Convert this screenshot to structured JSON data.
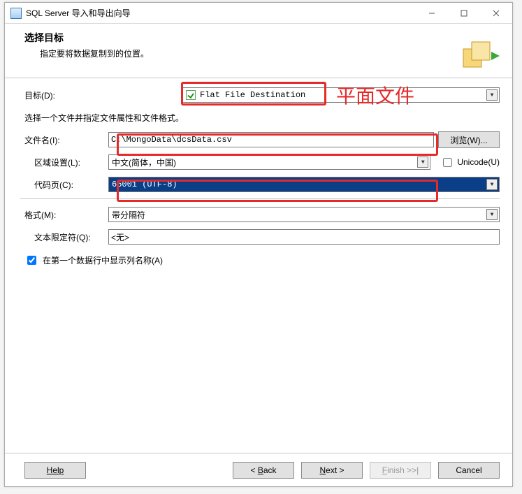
{
  "window": {
    "title": "SQL Server 导入和导出向导"
  },
  "header": {
    "title": "选择目标",
    "subtitle": "指定要将数据复制到的位置。"
  },
  "labels": {
    "destination": "目标(D):",
    "choose_file": "选择一个文件并指定文件属性和文件格式。",
    "filename": "文件名(I):",
    "locale": "区域设置(L):",
    "codepage": "代码页(C):",
    "format": "格式(M):",
    "text_qualifier": "文本限定符(Q):",
    "unicode": "Unicode(U)",
    "first_row_names": "在第一个数据行中显示列名称(A)"
  },
  "values": {
    "destination": "Flat File Destination",
    "filename": "C:\\MongoData\\dcsData.csv",
    "locale": "中文(简体，中国)",
    "codepage": "65001 (UTF-8)",
    "format": "带分隔符",
    "text_qualifier": "<无>",
    "unicode_checked": false,
    "first_row_checked": true
  },
  "buttons": {
    "browse": "浏览(W)...",
    "help": "Help",
    "back": "< Back",
    "next": "Next >",
    "finish": "Finish >>|",
    "cancel": "Cancel"
  },
  "annotations": {
    "text1": "平面文件"
  }
}
